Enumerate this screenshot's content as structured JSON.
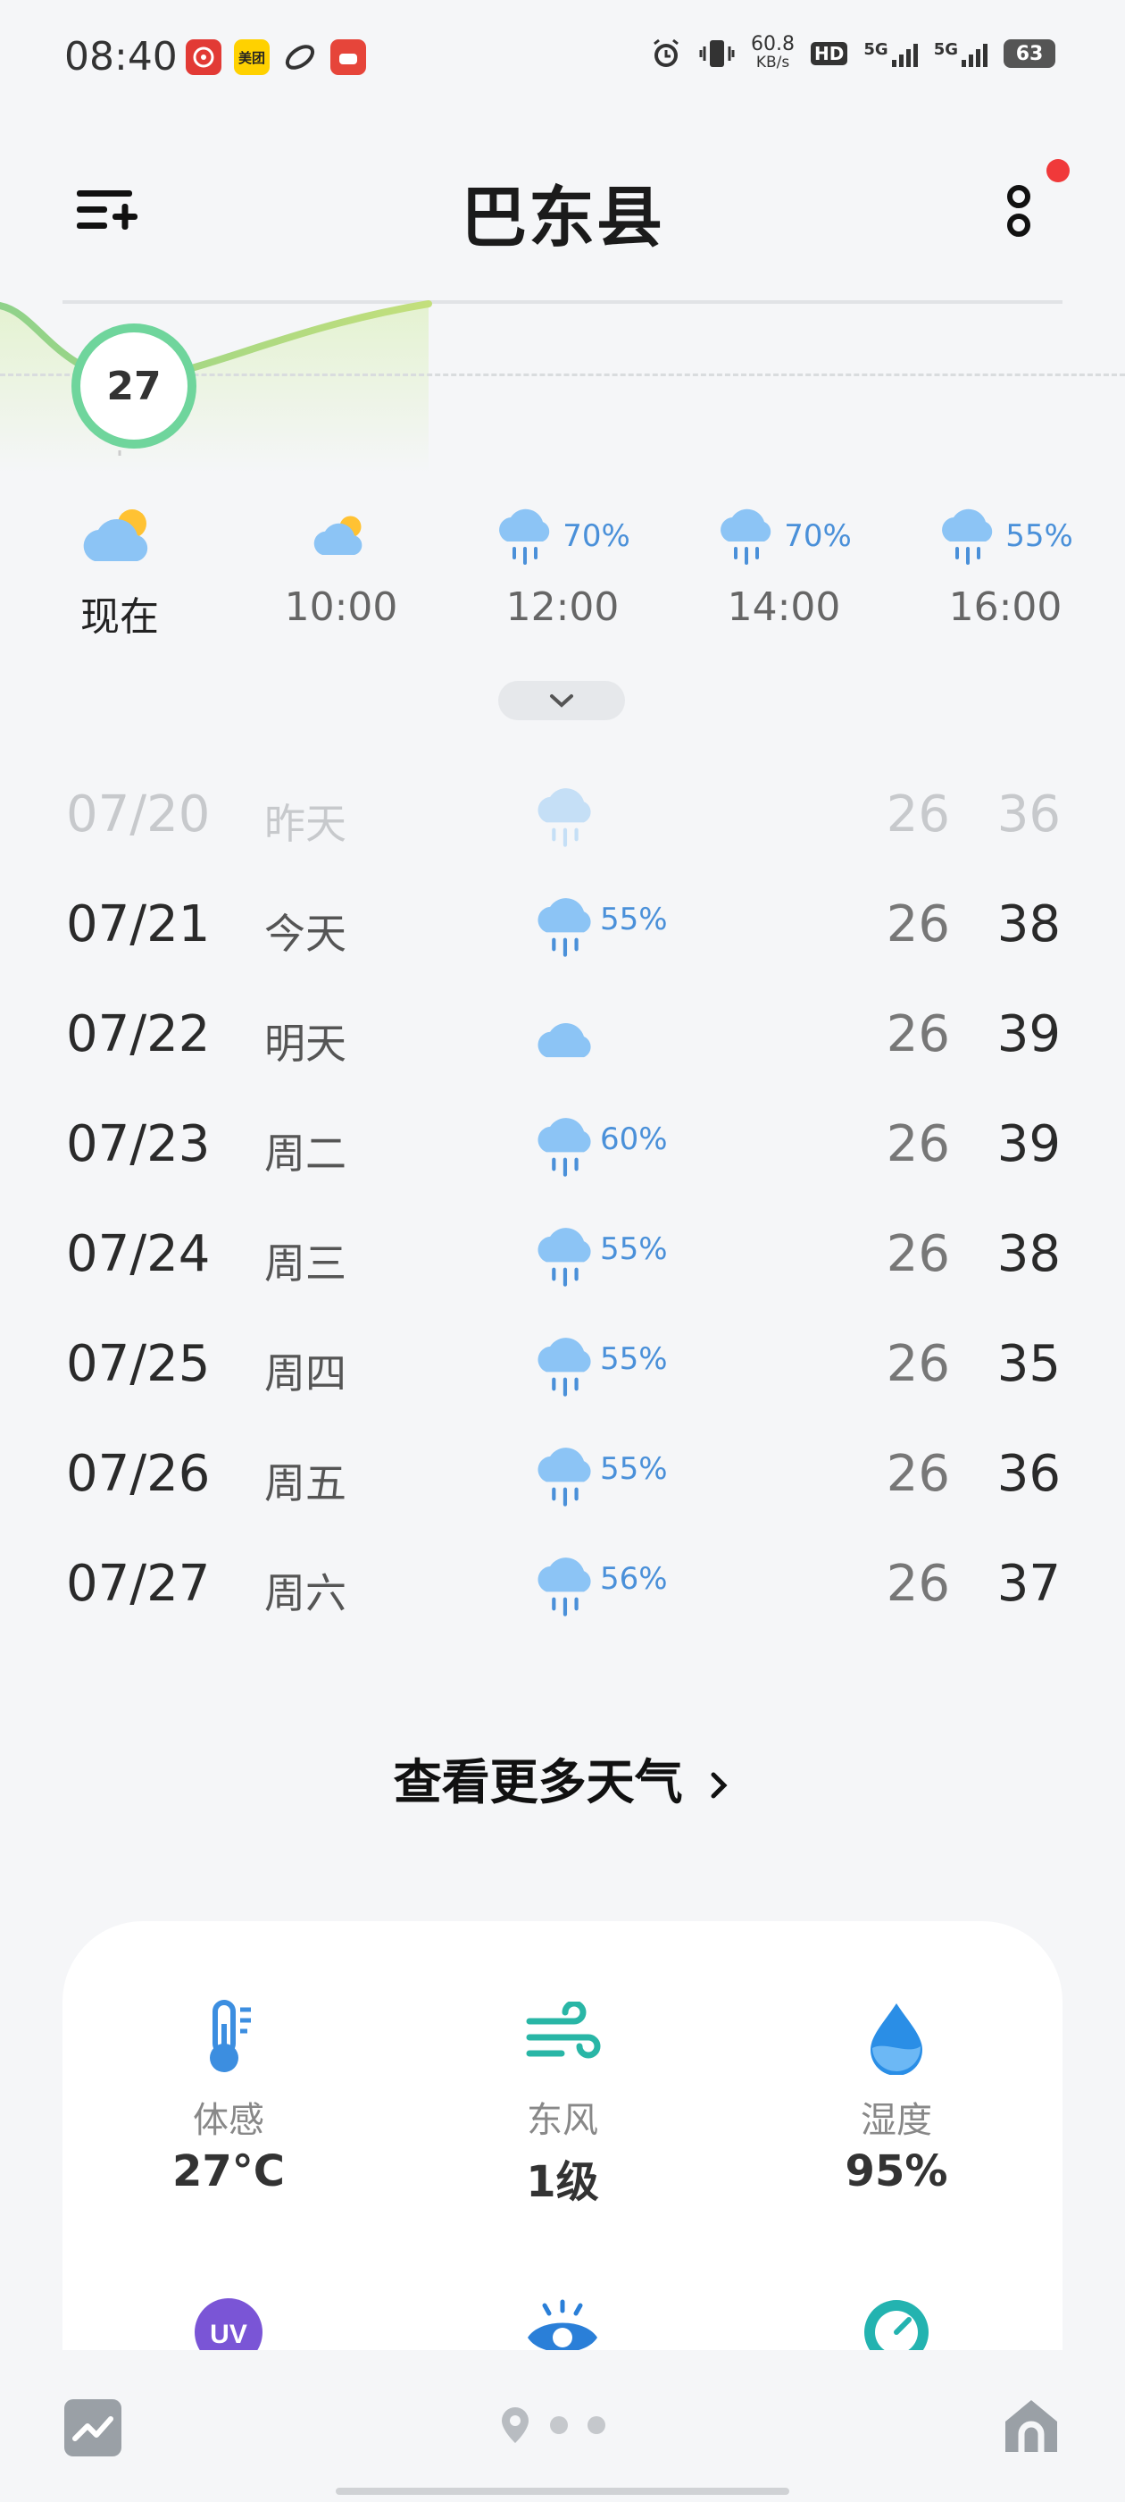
{
  "status_bar": {
    "time": "08:40",
    "net_speed_value": "60.8",
    "net_speed_unit": "KB/s",
    "hd_label": "HD",
    "sim1": "5G",
    "sim2": "5G",
    "battery": "63",
    "app_icons": [
      "netease-music-icon",
      "meituan-icon",
      "browser-icon",
      "game-icon"
    ],
    "meituan_label": "美团"
  },
  "header": {
    "city": "巴东县"
  },
  "hourly": {
    "current_temp": "27",
    "items": [
      {
        "label": "现在",
        "icon": "partly-cloudy-icon",
        "precip": ""
      },
      {
        "label": "10:00",
        "icon": "partly-cloudy-icon",
        "precip": ""
      },
      {
        "label": "12:00",
        "icon": "rain-icon",
        "precip": "70%"
      },
      {
        "label": "14:00",
        "icon": "rain-icon",
        "precip": "70%"
      },
      {
        "label": "16:00",
        "icon": "rain-icon",
        "precip": "55%"
      }
    ]
  },
  "daily": [
    {
      "date": "07/20",
      "day": "昨天",
      "icon": "rain-icon",
      "precip": "",
      "low": "26",
      "high": "36"
    },
    {
      "date": "07/21",
      "day": "今天",
      "icon": "rain-icon",
      "precip": "55%",
      "low": "26",
      "high": "38"
    },
    {
      "date": "07/22",
      "day": "明天",
      "icon": "cloudy-icon",
      "precip": "",
      "low": "26",
      "high": "39"
    },
    {
      "date": "07/23",
      "day": "周二",
      "icon": "rain-icon",
      "precip": "60%",
      "low": "26",
      "high": "39"
    },
    {
      "date": "07/24",
      "day": "周三",
      "icon": "rain-icon",
      "precip": "55%",
      "low": "26",
      "high": "38"
    },
    {
      "date": "07/25",
      "day": "周四",
      "icon": "rain-icon",
      "precip": "55%",
      "low": "26",
      "high": "35"
    },
    {
      "date": "07/26",
      "day": "周五",
      "icon": "rain-icon",
      "precip": "55%",
      "low": "26",
      "high": "36"
    },
    {
      "date": "07/27",
      "day": "周六",
      "icon": "rain-icon",
      "precip": "56%",
      "low": "26",
      "high": "37"
    }
  ],
  "more_weather": "查看更多天气",
  "details": {
    "feels_like": {
      "label": "体感",
      "value": "27°C"
    },
    "wind": {
      "label": "东风",
      "value": "1级"
    },
    "humidity": {
      "label": "湿度",
      "value": "95%"
    },
    "uv_badge": "UV"
  },
  "colors": {
    "accent_blue": "#4a90d9",
    "curve_green": "#6fd59c",
    "notification_red": "#f0393a"
  }
}
